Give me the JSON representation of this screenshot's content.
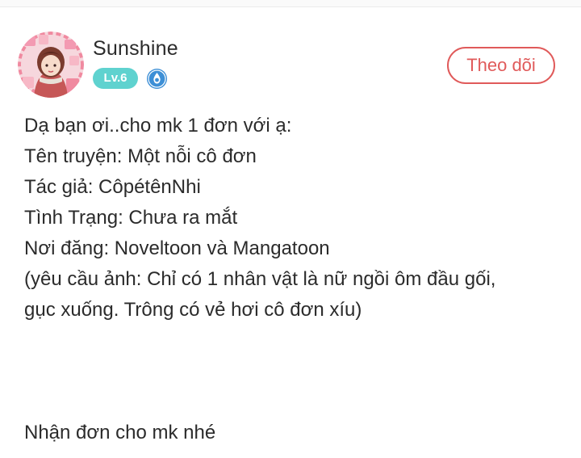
{
  "post": {
    "author": {
      "name": "Sunshine",
      "level": "Lv.6"
    },
    "follow_label": "Theo dõi",
    "content_lines": [
      "Dạ bạn ơi..cho mk 1 đơn với ạ:",
      "Tên truyện: Một nỗi cô đơn",
      "Tác giả: CôpétênNhi",
      "Tình Trạng: Chưa ra mắt",
      "Nơi đăng: Noveltoon và Mangatoon",
      "(yêu cầu ảnh: Chỉ có 1 nhân vật là nữ ngồi ôm đầu gối,",
      "gục xuống. Trông có vẻ hơi cô đơn xíu)"
    ],
    "closing_line": "Nhận đơn cho mk nhé"
  },
  "colors": {
    "accent": "#e05a5a",
    "level_badge": "#5fd2cf",
    "vip_badge": "#3d8fd6",
    "text": "#2b2b2b"
  },
  "icons": {
    "avatar": "user-avatar-illustration",
    "vip": "water-drop-badge-icon"
  }
}
